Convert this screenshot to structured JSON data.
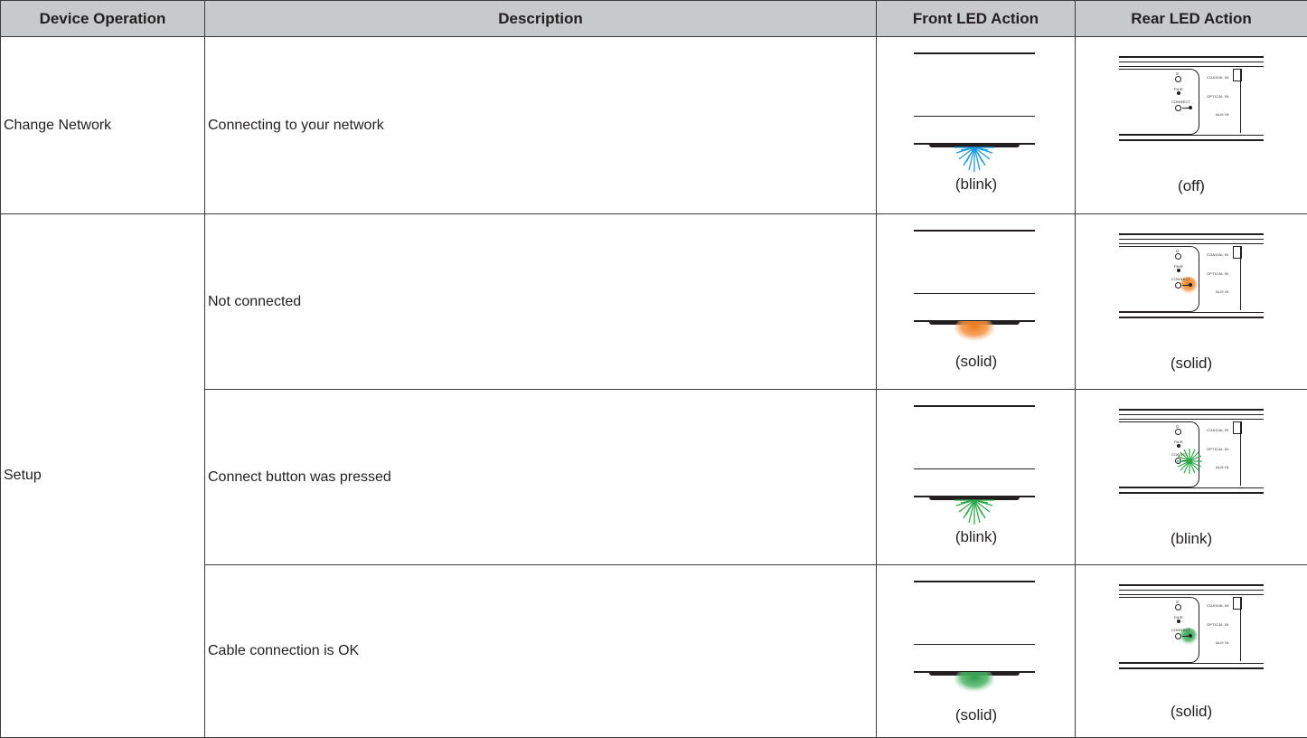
{
  "header": {
    "col_device_operation": "Device Operation",
    "col_description": "Description",
    "col_front_led": "Front LED Action",
    "col_rear_led": "Rear LED Action"
  },
  "rows": [
    {
      "operation": "Change Network",
      "description": "Connecting to your network",
      "front_state": "(blink)",
      "rear_state": "(off)",
      "front_color": "#1e9be0",
      "rear_color": "none"
    },
    {
      "operation": "Setup",
      "description": "Not connected",
      "front_state": "(solid)",
      "rear_state": "(solid)",
      "front_color": "#f07a1a",
      "rear_color": "#f07a1a"
    },
    {
      "description": "Connect button was pressed",
      "front_state": "(blink)",
      "rear_state": "(blink)",
      "front_color": "#2fa84a",
      "rear_color": "#2fa84a"
    },
    {
      "description": "Cable connection is OK",
      "front_state": "(solid)",
      "rear_state": "(solid)",
      "front_color": "#3aa357",
      "rear_color": "#3aa357"
    }
  ],
  "rear_panel_labels": {
    "power": "⏻",
    "pair": "PAIR",
    "connect": "CONNECT",
    "coaxial": "COAXIAL IN",
    "optical": "OPTICAL IN",
    "aux": "AUX IN"
  }
}
